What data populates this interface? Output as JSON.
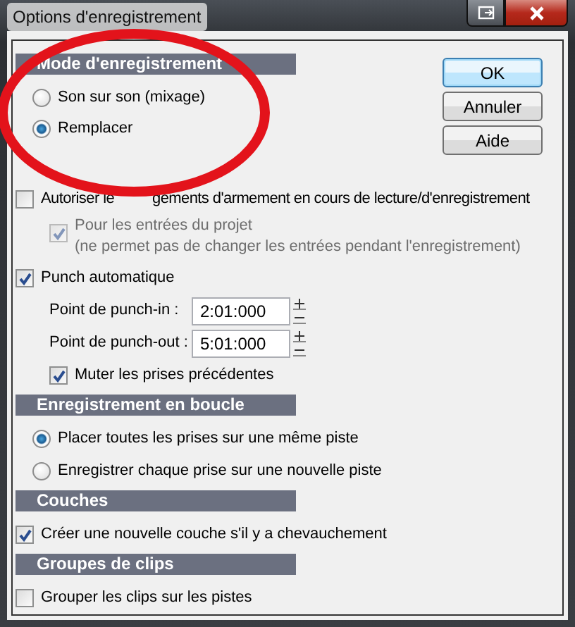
{
  "window": {
    "title": "Options d'enregistrement"
  },
  "buttons": [
    {
      "label": "OK",
      "default": true
    },
    {
      "label": "Annuler",
      "default": false
    },
    {
      "label": "Aide",
      "default": false
    }
  ],
  "rows": [
    {
      "kind": "header",
      "label": "Mode d'enregistrement"
    },
    {
      "kind": "radio",
      "label": "Son sur son (mixage)",
      "selected": false
    },
    {
      "kind": "radio",
      "label": "Remplacer",
      "selected": true
    },
    {
      "kind": "checkbox",
      "label_parts": [
        "Autoriser le",
        "gements d'armement en cours de lecture/d'enregistrement"
      ],
      "checked": false,
      "disabled": false,
      "children": [
        {
          "kind": "checkbox",
          "label": "Pour les entrées du projet",
          "note": "(ne permet pas de changer les entrées pendant l'enregistrement)",
          "checked": true,
          "disabled": true
        }
      ]
    },
    {
      "kind": "checkbox",
      "label": "Punch automatique",
      "checked": true,
      "disabled": false,
      "children": [
        {
          "kind": "field",
          "label": "Point de punch-in :",
          "value": "2:01:000"
        },
        {
          "kind": "field",
          "label": "Point de punch-out :",
          "value": "5:01:000"
        },
        {
          "kind": "checkbox",
          "label": "Muter les prises précédentes",
          "checked": true,
          "disabled": false
        }
      ]
    },
    {
      "kind": "header",
      "label": "Enregistrement en boucle"
    },
    {
      "kind": "radio",
      "label": "Placer toutes les prises sur une même piste",
      "selected": true
    },
    {
      "kind": "radio",
      "label": "Enregistrer chaque prise sur une nouvelle piste",
      "selected": false
    },
    {
      "kind": "header",
      "label": "Couches"
    },
    {
      "kind": "checkbox",
      "label": "Créer une nouvelle couche s'il y a chevauchement",
      "checked": true,
      "disabled": false
    },
    {
      "kind": "header",
      "label": "Groupes de clips"
    },
    {
      "kind": "checkbox",
      "label": "Grouper les clips sur les pistes",
      "checked": false,
      "disabled": false
    }
  ],
  "annotations": [
    {
      "kind": "ellipse"
    }
  ]
}
